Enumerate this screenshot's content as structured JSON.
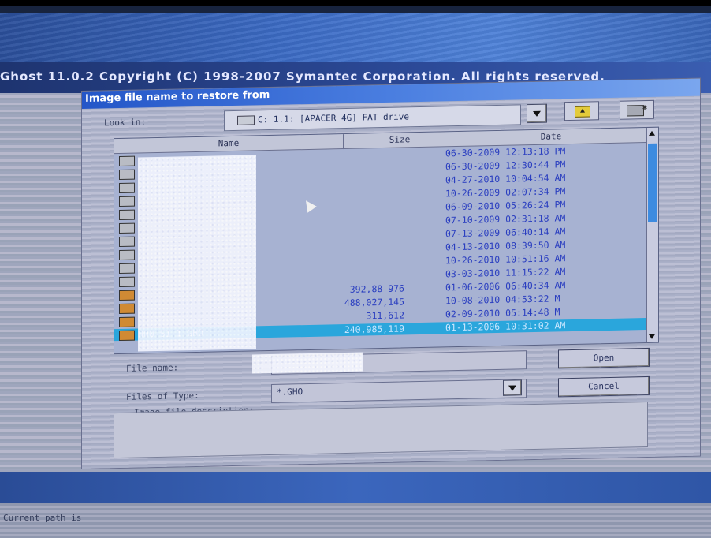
{
  "app": {
    "title": "Ghost 11.0.2  Copyright (C) 1998-2007 Symantec Corporation. All rights reserved."
  },
  "dialog": {
    "title": "Image file name to restore from",
    "look_in_label": "Look in:",
    "look_in_value": "C: 1.1: [APACER 4G] FAT drive",
    "columns": [
      "Name",
      "Size",
      "Date"
    ],
    "rows": [
      {
        "name": "",
        "size": "",
        "date": "06-30-2009 12:13:18 PM",
        "icon": "folder-icon",
        "selected": false
      },
      {
        "name": "",
        "size": "",
        "date": "06-30-2009 12:30:44 PM",
        "icon": "folder-icon",
        "selected": false
      },
      {
        "name": "",
        "size": "",
        "date": "04-27-2010 10:04:54 AM",
        "icon": "folder-icon",
        "selected": false
      },
      {
        "name": "",
        "size": "",
        "date": "10-26-2009 02:07:34 PM",
        "icon": "folder-icon",
        "selected": false
      },
      {
        "name": "",
        "size": "",
        "date": "06-09-2010 05:26:24 PM",
        "icon": "folder-icon",
        "selected": false
      },
      {
        "name": "",
        "size": "",
        "date": "07-10-2009 02:31:18 AM",
        "icon": "folder-icon",
        "selected": false
      },
      {
        "name": "",
        "size": "",
        "date": "07-13-2009 06:40:14 AM",
        "icon": "folder-icon",
        "selected": false
      },
      {
        "name": "",
        "size": "",
        "date": "04-13-2010 08:39:50 AM",
        "icon": "folder-icon",
        "selected": false
      },
      {
        "name": "",
        "size": "",
        "date": "10-26-2010 10:51:16 AM",
        "icon": "folder-icon",
        "selected": false
      },
      {
        "name": "",
        "size": "",
        "date": "03-03-2010 11:15:22 AM",
        "icon": "folder-icon",
        "selected": false
      },
      {
        "name": "",
        "size": "392,88 976",
        "date": "01-06-2006 06:40:34 AM",
        "icon": "image-file-icon",
        "selected": false
      },
      {
        "name": "",
        "size": "488,027,145",
        "date": "10-08-2010 04:53:22 M",
        "icon": "image-file-icon",
        "selected": false
      },
      {
        "name": "",
        "size": "311,612",
        "date": "02-09-2010 05:14:48 M",
        "icon": "image-file-icon",
        "selected": false
      },
      {
        "name": "H00 S1 1.GHO",
        "size": "240,985,119",
        "date": "01-13-2006 10:31:02 AM",
        "icon": "image-file-icon",
        "selected": true
      }
    ],
    "file_name_label": "File name:",
    "file_name_value": "",
    "files_of_type_label": "Files of Type:",
    "files_of_type_value": "*.GHO",
    "description_label": "Image file description:",
    "open_button": "Open",
    "cancel_button": "Cancel"
  },
  "status": {
    "current_path_label": "Current path is"
  },
  "colors": {
    "title_bar": "#2456c8",
    "selection": "#2aa6dc",
    "list_text": "#2a3ec0"
  }
}
